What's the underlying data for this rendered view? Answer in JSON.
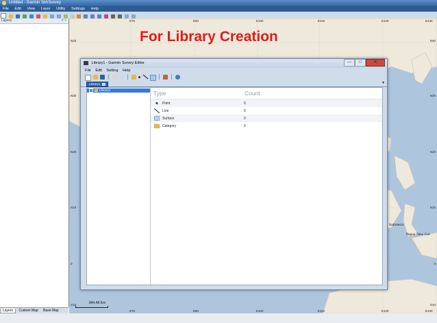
{
  "app": {
    "title": "Untitled - Garmin SimSurvey",
    "menu": [
      "File",
      "Edit",
      "View",
      "Layer",
      "Utility",
      "Settings",
      "Help"
    ]
  },
  "layers_panel": {
    "title": "Layers",
    "pin": "# ×"
  },
  "bottom_tabs": [
    "Layers",
    "Custom Map",
    "Base Map"
  ],
  "overlay_title": "For Library Creation",
  "map": {
    "lon_labels_top": [
      "E75",
      "E80",
      "E100",
      "E110",
      "E120",
      "E130"
    ],
    "lon_labels_bottom": [
      "E70",
      "E80",
      "E100",
      "E110",
      "E120",
      "E130"
    ],
    "lat_labels_left": [
      "N40",
      "N30",
      "N20",
      "N10",
      "0",
      "S10"
    ],
    "lat_labels_right": [
      "N40",
      "N30",
      "N20",
      "N10",
      "0",
      "S10"
    ],
    "place_names": [
      "Indonesia",
      "Papua New Gui"
    ],
    "scale": "844.48 Km",
    "colors": {
      "sea": "#aec6dd",
      "land": "#efe9dc"
    }
  },
  "dialog": {
    "title": "Library1 - Garmin Survey Editor",
    "controls": {
      "minimize": "—",
      "maximize": "□",
      "close": "✕"
    },
    "menu": [
      "File",
      "Edit",
      "Setting",
      "Help"
    ],
    "tab_label": "Library1",
    "tab_close": "×",
    "dropdown_arrow": "▼",
    "tree_item": "Library1",
    "tree_expander": "−",
    "columns": {
      "type": "Type",
      "count": "Count"
    },
    "rows": [
      {
        "name": "Point",
        "count": "0",
        "icon": "point-icon"
      },
      {
        "name": "Line",
        "count": "0",
        "icon": "line-icon"
      },
      {
        "name": "Surface",
        "count": "0",
        "icon": "surface-icon"
      },
      {
        "name": "Category",
        "count": "0",
        "icon": "folder-icon"
      }
    ],
    "colors": {
      "accent": "#2d63b1",
      "selection": "#3b79d3",
      "close": "#c94a3c"
    }
  }
}
